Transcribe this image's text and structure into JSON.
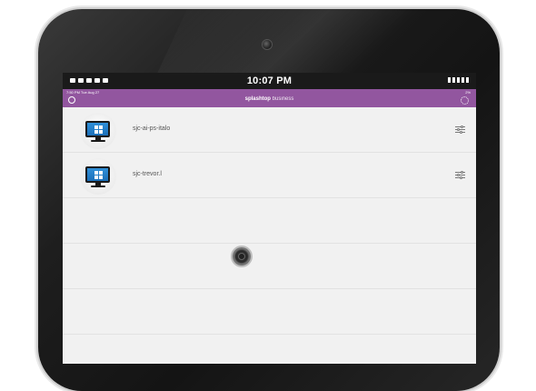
{
  "device": {
    "status_time": "10:07 PM"
  },
  "app": {
    "inner_time": "7:50 PM   Tue Aug 27",
    "inner_status": "2%",
    "brand_name": "splashtop",
    "brand_suffix": "business"
  },
  "computers": [
    {
      "name": "sjc-ai-ps-italo",
      "icon": "windows-monitor-icon"
    },
    {
      "name": "sjc-trevor.l",
      "icon": "windows-monitor-icon"
    }
  ],
  "colors": {
    "app_bar": "#92569f",
    "screen_bg": "#f1f1f1"
  }
}
